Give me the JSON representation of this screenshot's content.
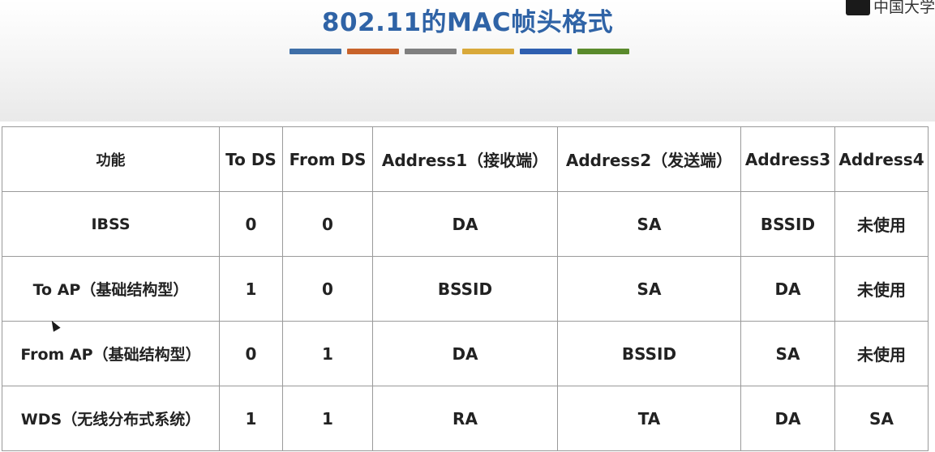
{
  "slide": {
    "title": "802.11的MAC帧头格式",
    "logo_text": "中国大学",
    "color_bars": [
      "#3f6fa8",
      "#c8632b",
      "#808080",
      "#d9a93a",
      "#2f5fb0",
      "#5a8a2c"
    ]
  },
  "table": {
    "headers": [
      "功能",
      "To DS",
      "From DS",
      "Address1（接收端）",
      "Address2（发送端）",
      "Address3",
      "Address4"
    ],
    "rows": [
      [
        "IBSS",
        "0",
        "0",
        "DA",
        "SA",
        "BSSID",
        "未使用"
      ],
      [
        "To AP（基础结构型）",
        "1",
        "0",
        "BSSID",
        "SA",
        "DA",
        "未使用"
      ],
      [
        "From AP（基础结构型）",
        "0",
        "1",
        "DA",
        "BSSID",
        "SA",
        "未使用"
      ],
      [
        "WDS（无线分布式系统）",
        "1",
        "1",
        "RA",
        "TA",
        "DA",
        "SA"
      ]
    ]
  }
}
